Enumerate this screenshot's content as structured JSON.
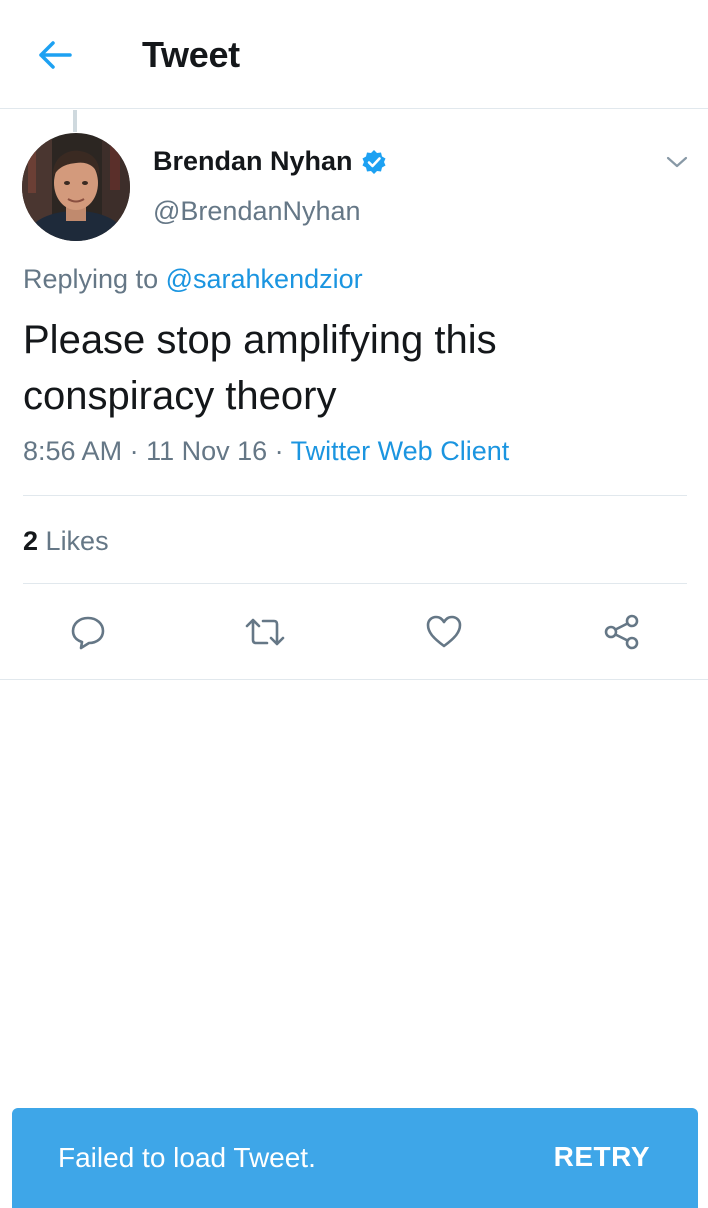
{
  "header": {
    "title": "Tweet",
    "back_icon": "arrow-left-icon",
    "accent": "#1da1f2"
  },
  "tweet": {
    "author": {
      "name": "Brendan Nyhan",
      "handle": "@BrendanNyhan",
      "verified": true
    },
    "replying_prefix": "Replying to",
    "replying_to": "@sarahkendzior",
    "text": "Please stop amplifying this conspiracy theory",
    "time": "8:56 AM",
    "sep1": " · ",
    "date": "11 Nov 16",
    "sep2": " · ",
    "source": "Twitter Web Client",
    "likes_count": "2",
    "likes_label": "Likes"
  },
  "actions": [
    "reply-icon",
    "retweet-icon",
    "like-icon",
    "share-icon"
  ],
  "toast": {
    "message": "Failed to load Tweet.",
    "action": "RETRY",
    "color": "#3ea6e8"
  },
  "colors": {
    "link": "#1b95e0",
    "secondary_text": "#657786",
    "divider": "#e1e8ed"
  }
}
